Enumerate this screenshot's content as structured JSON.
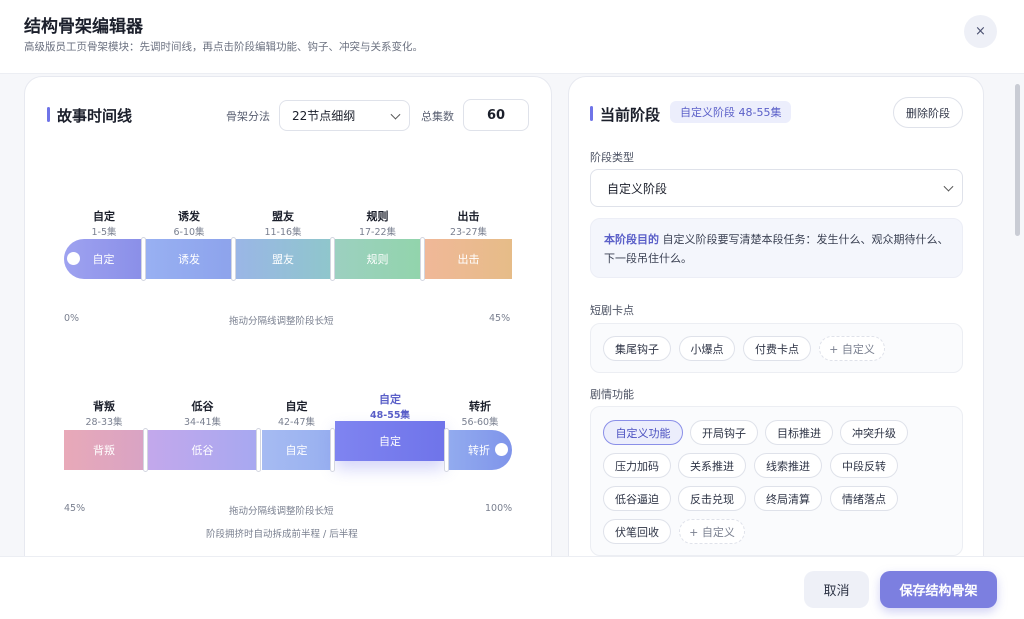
{
  "header": {
    "title": "结构骨架编辑器",
    "subtitle": "高级版员工页骨架模块：先调时间线，再点击阶段编辑功能、钩子、冲突与关系变化。",
    "close_icon": "×"
  },
  "timeline": {
    "title": "故事时间线",
    "method_label": "骨架分法",
    "method_value": "22节点细纲",
    "total_label": "总集数",
    "total_value": "60",
    "row1": {
      "stages": [
        {
          "name": "自定",
          "range": "1-5集",
          "label": "自定",
          "color": "#8f93ec"
        },
        {
          "name": "诱发",
          "range": "6-10集",
          "label": "诱发",
          "color": "#93aaf0"
        },
        {
          "name": "盟友",
          "range": "11-16集",
          "label": "盟友",
          "color": "#93c0d4"
        },
        {
          "name": "规则",
          "range": "17-22集",
          "label": "规则",
          "color": "#98d2b6"
        },
        {
          "name": "出击",
          "range": "23-27集",
          "label": "出击",
          "color": "#ecb88c"
        }
      ],
      "start": "0%",
      "hint": "拖动分隔线调整阶段长短",
      "end": "45%"
    },
    "row2": {
      "stages": [
        {
          "name": "背叛",
          "range": "28-33集",
          "label": "背叛",
          "color": "#e3a4b6"
        },
        {
          "name": "低谷",
          "range": "34-41集",
          "label": "低谷",
          "color": "#b4aaee"
        },
        {
          "name": "自定",
          "range": "42-47集",
          "label": "自定",
          "color": "#9fb6f2"
        },
        {
          "name": "自定",
          "range": "48-55集",
          "label": "自定",
          "color": "#7479ee"
        },
        {
          "name": "转折",
          "range": "56-60集",
          "label": "转折",
          "color": "#89a3ef"
        }
      ],
      "start": "45%",
      "hint": "拖动分隔线调整阶段长短",
      "end": "100%",
      "note": "阶段拥挤时自动拆成前半程 / 后半程"
    }
  },
  "current_stage": {
    "title": "当前阶段",
    "tag": "自定义阶段 48-55集",
    "delete_label": "删除阶段",
    "type_label": "阶段类型",
    "type_value": "自定义阶段",
    "purpose_title": "本阶段目的",
    "purpose_text": "自定义阶段要写清楚本段任务：发生什么、观众期待什么、下一段吊住什么。",
    "hooks_label": "短剧卡点",
    "hooks": [
      "集尾钩子",
      "小爆点",
      "付费卡点",
      "+ 自定义"
    ],
    "functions_label": "剧情功能",
    "functions": [
      "自定义功能",
      "开局钩子",
      "目标推进",
      "冲突升级",
      "压力加码",
      "关系推进",
      "线索推进",
      "中段反转",
      "低谷逼迫",
      "反击兑现",
      "终局清算",
      "情绪落点",
      "伏笔回收",
      "+ 自定义"
    ]
  },
  "footer": {
    "cancel_label": "取消",
    "save_label": "保存结构骨架"
  }
}
